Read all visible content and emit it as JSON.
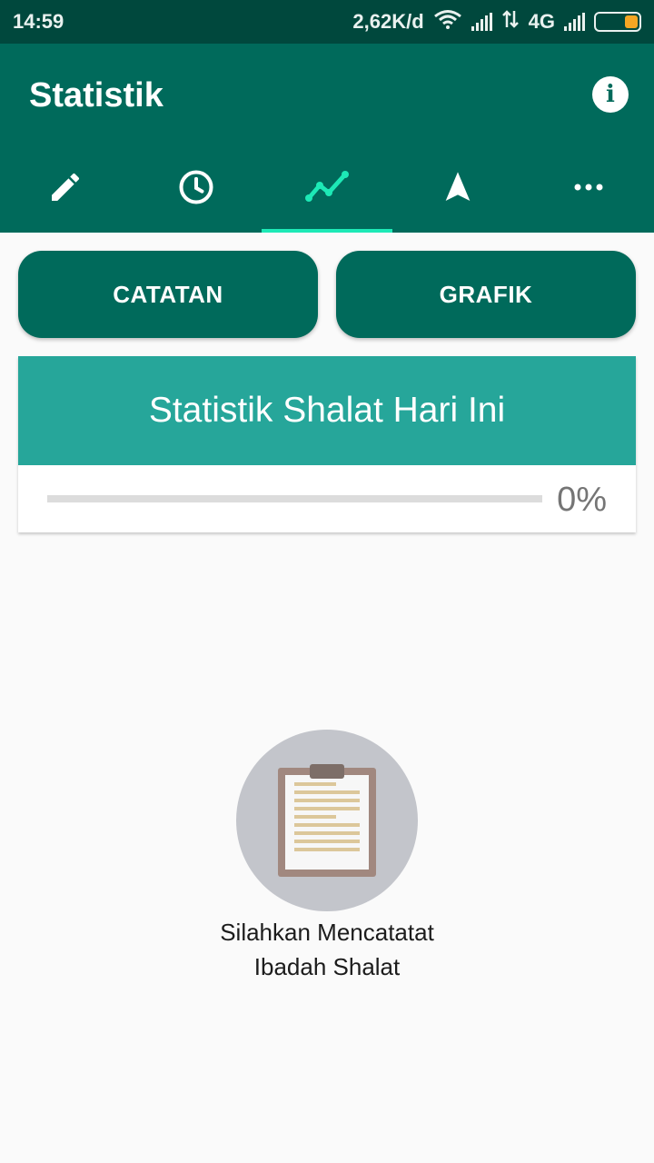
{
  "status_bar": {
    "time": "14:59",
    "network_speed": "2,62K/d",
    "network_type": "4G",
    "icons": [
      "wifi-icon",
      "signal-icon",
      "data-arrows-icon",
      "signal-icon",
      "battery-icon"
    ],
    "battery_color": "#f5a623"
  },
  "app_bar": {
    "title": "Statistik",
    "info_icon": "info-icon",
    "color": "#006a5b"
  },
  "tabs": [
    {
      "icon": "pencil-icon",
      "active": false
    },
    {
      "icon": "clock-icon",
      "active": false
    },
    {
      "icon": "trend-chart-icon",
      "active": true
    },
    {
      "icon": "navigation-arrow-icon",
      "active": false
    },
    {
      "icon": "more-dots-icon",
      "active": false
    }
  ],
  "buttons": {
    "catatan": "CATATAN",
    "grafik": "GRAFIK"
  },
  "stats_card": {
    "title": "Statistik Shalat Hari Ini",
    "progress_percent": 0,
    "progress_label": "0%"
  },
  "empty_state": {
    "icon": "clipboard-icon",
    "line1": "Silahkan Mencatatat",
    "line2": "Ibadah Shalat"
  }
}
